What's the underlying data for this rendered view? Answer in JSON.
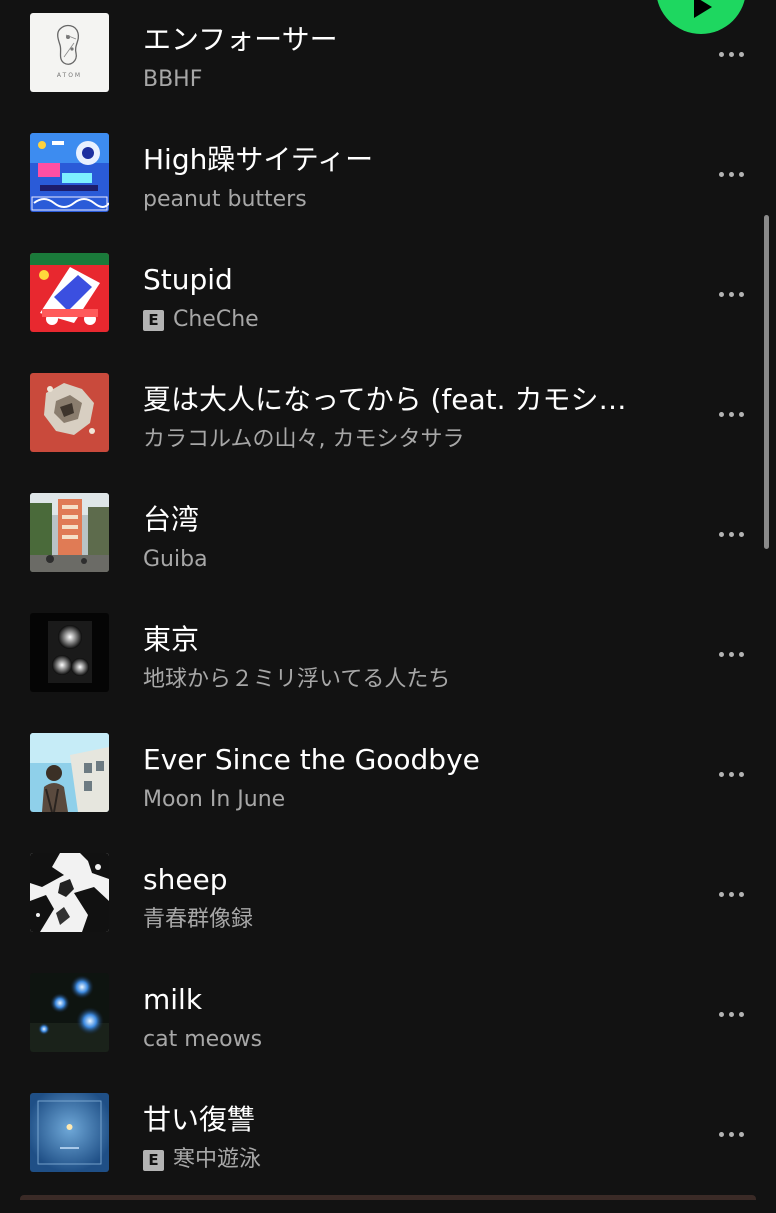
{
  "play_button": {
    "icon": "play-icon",
    "color": "#1ed760"
  },
  "tracks": [
    {
      "title": "エンフォーサー",
      "artist": "BBHF",
      "explicit": false,
      "cover_text": "ATOM"
    },
    {
      "title": "High躁サイティー",
      "artist": "peanut butters",
      "explicit": false
    },
    {
      "title": "Stupid",
      "artist": "CheChe",
      "explicit": true
    },
    {
      "title": "夏は大人になってから (feat. カモシ…",
      "artist": "カラコルムの山々, カモシタサラ",
      "explicit": false
    },
    {
      "title": "台湾",
      "artist": "Guiba",
      "explicit": false
    },
    {
      "title": "東京",
      "artist": "地球から２ミリ浮いてる人たち",
      "explicit": false
    },
    {
      "title": "Ever Since the Goodbye",
      "artist": "Moon In June",
      "explicit": false
    },
    {
      "title": "sheep",
      "artist": "青春群像録",
      "explicit": false
    },
    {
      "title": "milk",
      "artist": "cat meows",
      "explicit": false
    },
    {
      "title": "甘い復讐",
      "artist": "寒中遊泳",
      "explicit": true
    }
  ],
  "explicit_label": "E",
  "more_icon": "more-horizontal-icon",
  "colors": {
    "background": "#121212",
    "title": "#ffffff",
    "artist": "#a7a7a7",
    "accent": "#1ed760"
  }
}
